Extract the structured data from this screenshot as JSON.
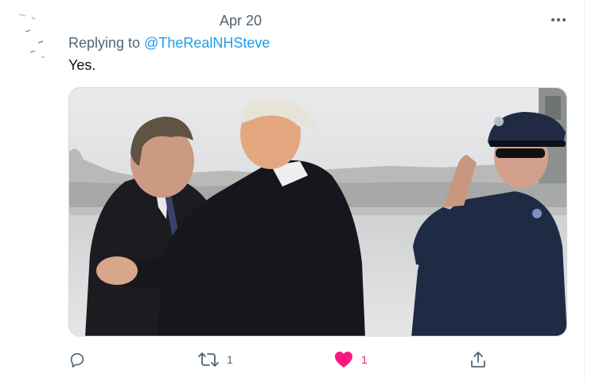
{
  "tweet": {
    "date": "Apr 20",
    "replying_prefix": "Replying to ",
    "replying_handle": "@TheRealNHSteve",
    "text": "Yes."
  },
  "media": {
    "alt": "Photo of two men in dark coats greeting each other on an airfield tarmac while a uniformed officer salutes"
  },
  "actions": {
    "reply_count": "",
    "retweet_count": "1",
    "like_count": "1",
    "liked": true
  },
  "colors": {
    "text_primary": "#0f1419",
    "text_secondary": "#536471",
    "link": "#1d9bf0",
    "like": "#f91880",
    "border": "#cfd9de"
  },
  "icons": {
    "more": "more-icon",
    "reply": "reply-icon",
    "retweet": "retweet-icon",
    "like": "heart-icon",
    "share": "share-icon"
  }
}
